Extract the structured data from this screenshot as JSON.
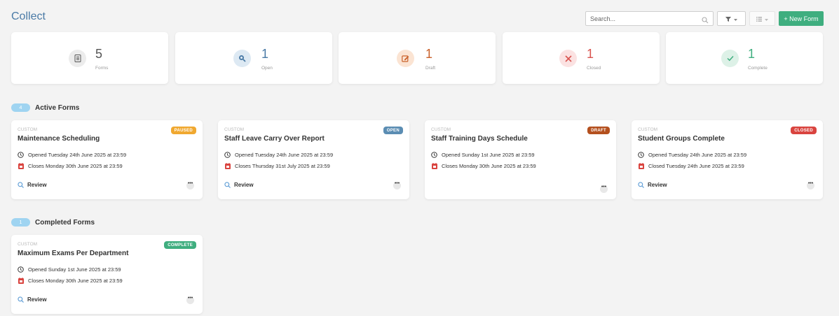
{
  "header": {
    "title": "Collect",
    "search_placeholder": "Search...",
    "new_form_label": "+ New Form"
  },
  "stats": [
    {
      "value": "5",
      "label": "Forms",
      "icon": "document-icon",
      "color": "#555555",
      "bg": "#ececec"
    },
    {
      "value": "1",
      "label": "Open",
      "icon": "search-icon",
      "color": "#4a7aa6",
      "bg": "#dde9f3"
    },
    {
      "value": "1",
      "label": "Draft",
      "icon": "edit-icon",
      "color": "#c9602a",
      "bg": "#fbe4d3"
    },
    {
      "value": "1",
      "label": "Closed",
      "icon": "close-icon",
      "color": "#d9534f",
      "bg": "#fbe2e2"
    },
    {
      "value": "1",
      "label": "Complete",
      "icon": "check-icon",
      "color": "#3fae7f",
      "bg": "#ddf1e7"
    }
  ],
  "sections": {
    "active": {
      "count": "4",
      "title": "Active Forms"
    },
    "completed": {
      "count": "1",
      "title": "Completed Forms"
    }
  },
  "cards": [
    {
      "type": "CUSTOM",
      "title": "Maintenance Scheduling",
      "badge": "PAUSED",
      "badge_color": "#f0a830",
      "opened": "Opened Tuesday 24th June 2025 at 23:59",
      "closes": "Closes Monday 30th June 2025 at 23:59",
      "review": "Review"
    },
    {
      "type": "CUSTOM",
      "title": "Staff Leave Carry Over Report",
      "badge": "OPEN",
      "badge_color": "#5b8db3",
      "opened": "Opened Tuesday 24th June 2025 at 23:59",
      "closes": "Closes Thursday 31st July 2025 at 23:59",
      "review": "Review"
    },
    {
      "type": "CUSTOM",
      "title": "Staff Training Days Schedule",
      "badge": "DRAFT",
      "badge_color": "#b4501e",
      "opened": "Opened Sunday 1st June 2025 at 23:59",
      "closes": "Closes Monday 30th June 2025 at 23:59",
      "review": ""
    },
    {
      "type": "CUSTOM",
      "title": "Student Groups Complete",
      "badge": "CLOSED",
      "badge_color": "#d9443f",
      "opened": "Opened Tuesday 24th June 2025 at 23:59",
      "closes": "Closed Tuesday 24th June 2025 at 23:59",
      "review": "Review"
    },
    {
      "type": "CUSTOM",
      "title": "Maximum Exams Per Department",
      "badge": "COMPLETE",
      "badge_color": "#3fae7f",
      "opened": "Opened Sunday 1st June 2025 at 23:59",
      "closes": "Closes Monday 30th June 2025 at 23:59",
      "review": "Review"
    }
  ]
}
